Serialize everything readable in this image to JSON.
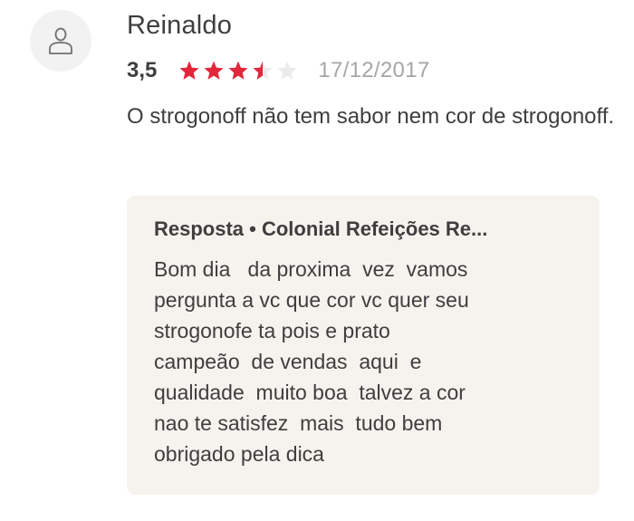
{
  "review": {
    "author": "Reinaldo",
    "rating": 3.5,
    "rating_label": "3,5",
    "max_rating": 5,
    "date": "17/12/2017",
    "text": "O strogonoff não tem sabor nem cor de strogonoff."
  },
  "reply": {
    "title": "Resposta • Colonial Refeições Re...",
    "text": "Bom dia   da proxima  vez  vamos\npergunta a vc que cor vc quer seu\nstrogonofe ta pois e prato\ncampeão  de vendas  aqui  e\nqualidade  muito boa  talvez a cor\nnao te satisfez  mais  tudo bem\nobrigado pela dica"
  },
  "icons": {
    "avatar": "user-icon",
    "star": "star-icon"
  },
  "colors": {
    "star_filled": "#e2263b",
    "star_empty": "#ebebeb",
    "date": "#a6a6a6",
    "reply_background": "#f6f3ee",
    "avatar_background": "#f2f2f2"
  }
}
